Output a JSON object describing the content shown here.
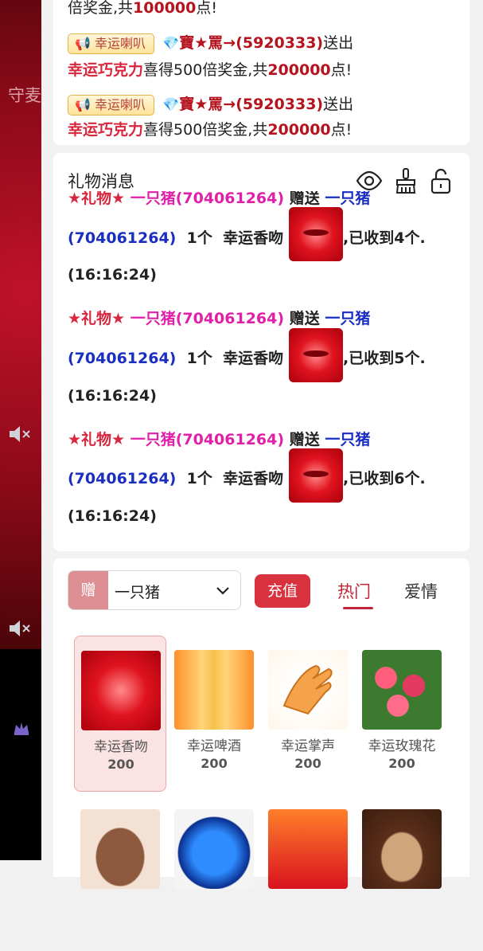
{
  "background": {
    "top_text": "守麦",
    "accent_color": "#8a0a18"
  },
  "broadcast": {
    "line0_prefix": "倍奖金,共",
    "line0_amount": "100000",
    "line0_suffix": "点!",
    "items": [
      {
        "badge": "幸运喇叭",
        "sender": "寶★罵→(5920333)",
        "action": "送出",
        "gift": "幸运巧克力",
        "text": "喜得500倍奖金,共",
        "amount": "200000",
        "suffix": "点!"
      },
      {
        "badge": "幸运喇叭",
        "sender": "寶★罵→(5920333)",
        "action": "送出",
        "gift": "幸运巧克力",
        "text": "喜得500倍奖金,共",
        "amount": "200000",
        "suffix": "点!"
      }
    ]
  },
  "gift_messages": {
    "title": "礼物消息",
    "partial_top": {
      "prefix": "★礼物★",
      "sender": "一只猪(704061264)",
      "verb": "赠送",
      "receiver": "一只猪",
      "receiver_id": "(704061264)",
      "count": "1个",
      "gift": "幸运香吻",
      "received": ",已收到4个.",
      "time": "(16:16:24)"
    },
    "items": [
      {
        "prefix": "★礼物★",
        "sender": "一只猪(704061264)",
        "verb": "赠送",
        "receiver": "一只猪",
        "receiver_id": "(704061264)",
        "count": "1个",
        "gift": "幸运香吻",
        "received": ",已收到5个.",
        "time": "(16:16:24)"
      },
      {
        "prefix": "★礼物★",
        "sender": "一只猪(704061264)",
        "verb": "赠送",
        "receiver": "一只猪",
        "receiver_id": "(704061264)",
        "count": "1个",
        "gift": "幸运香吻",
        "received": ",已收到6个.",
        "time": "(16:16:24)"
      }
    ]
  },
  "gift_panel": {
    "send_tag": "赠",
    "recipient": "一只猪",
    "recharge": "充值",
    "tabs": [
      {
        "label": "热门",
        "active": true
      },
      {
        "label": "爱情",
        "active": false
      }
    ],
    "gifts": [
      {
        "name": "幸运香吻",
        "price": "200",
        "icon": "kiss-icon"
      },
      {
        "name": "幸运啤酒",
        "price": "200",
        "icon": "beer-icon"
      },
      {
        "name": "幸运掌声",
        "price": "200",
        "icon": "clap-icon"
      },
      {
        "name": "幸运玫瑰花",
        "price": "200",
        "icon": "rose-icon"
      }
    ],
    "second_row_icons": [
      "chocolate-heart-icon",
      "blue-rose-icon",
      "red-envelope-icon",
      "coffee-icon"
    ]
  },
  "colors": {
    "accent": "#d8323f",
    "sender": "#e020a8",
    "receiver": "#1a2fc0",
    "highlight": "#d7263d"
  }
}
